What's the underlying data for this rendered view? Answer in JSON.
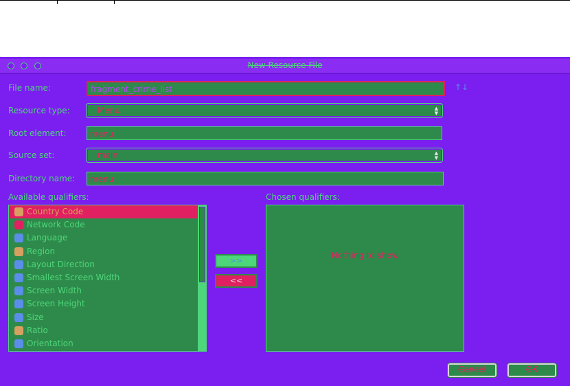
{
  "window": {
    "title": "New Resource File"
  },
  "form": {
    "file_name_label": "File name:",
    "file_name_value": "fragment_crime_list",
    "resource_type_label": "Resource type:",
    "resource_type_value": "Menu",
    "root_element_label": "Root element:",
    "root_element_value": "menu",
    "source_set_label": "Source set:",
    "source_set_value": "main",
    "directory_name_label": "Directory name:",
    "directory_name_value": "menu"
  },
  "qualifiers": {
    "available_label": "Available qualifiers:",
    "chosen_label": "Chosen qualifiers:",
    "empty_text": "Nothing to show",
    "add_label": ">>",
    "remove_label": "<<",
    "items": [
      {
        "label": "Country Code",
        "icon": "globe-icon",
        "color": "#d8a060"
      },
      {
        "label": "Network Code",
        "icon": "network-icon",
        "color": "#e02060"
      },
      {
        "label": "Language",
        "icon": "language-icon",
        "color": "#5a8ee8"
      },
      {
        "label": "Region",
        "icon": "region-icon",
        "color": "#d8a060"
      },
      {
        "label": "Layout Direction",
        "icon": "layout-direction-icon",
        "color": "#5a8ee8"
      },
      {
        "label": "Smallest Screen Width",
        "icon": "smallest-width-icon",
        "color": "#5a8ee8"
      },
      {
        "label": "Screen Width",
        "icon": "screen-width-icon",
        "color": "#5a8ee8"
      },
      {
        "label": "Screen Height",
        "icon": "screen-height-icon",
        "color": "#5a8ee8"
      },
      {
        "label": "Size",
        "icon": "size-icon",
        "color": "#5a8ee8"
      },
      {
        "label": "Ratio",
        "icon": "ratio-icon",
        "color": "#d8a060"
      },
      {
        "label": "Orientation",
        "icon": "orientation-icon",
        "color": "#5a8ee8"
      }
    ]
  },
  "buttons": {
    "cancel": "Cancel",
    "ok": "OK"
  }
}
